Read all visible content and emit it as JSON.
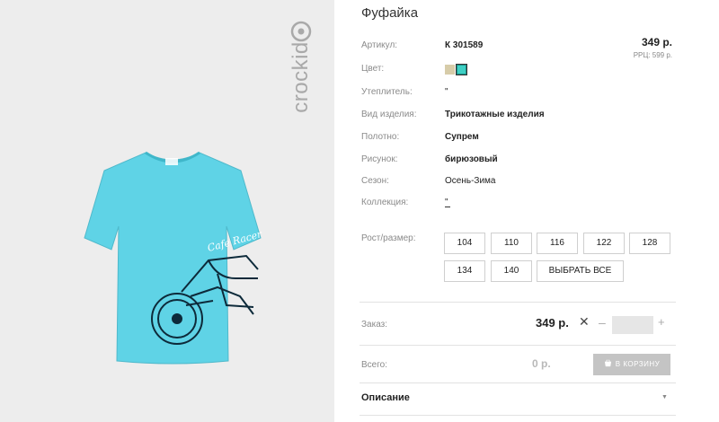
{
  "product": {
    "title": "Фуфайка",
    "brand": "crockid",
    "price": "349 р.",
    "rrp": "РРЦ: 599 р.",
    "print_text": "Cafe Racer"
  },
  "attributes": [
    {
      "label": "Артикул:",
      "value": "К 301589",
      "bold": true
    },
    {
      "label": "Цвет:",
      "value": ""
    },
    {
      "label": "Утеплитель:",
      "value": "\""
    },
    {
      "label": "Вид изделия:",
      "value": "Трикотажные изделия",
      "bold": true
    },
    {
      "label": "Полотно:",
      "value": "Супрем",
      "bold": true
    },
    {
      "label": "Рисунок:",
      "value": "бирюзовый",
      "bold": true
    },
    {
      "label": "Сезон:",
      "value": "Осень-Зима"
    },
    {
      "label": "Коллекция:",
      "value": "\""
    }
  ],
  "colors": {
    "swatch_beige": "#d7cca9",
    "swatch_turquoise": "#3fcfc4",
    "shirt": "#5fd3e6",
    "photo_bg": "#ededed",
    "button_gray": "#c4c4c4"
  },
  "sizes": {
    "label": "Рост/размер:",
    "options": [
      "104",
      "110",
      "116",
      "122",
      "128",
      "134",
      "140"
    ],
    "select_all": "ВЫБРАТЬ ВСЕ"
  },
  "order": {
    "label": "Заказ:",
    "price": "349 р.",
    "remove": "✕",
    "minus": "–",
    "plus": "+",
    "quantity": ""
  },
  "total": {
    "label": "Всего:",
    "value": "0 р.",
    "cart_button": "В КОРЗИНУ"
  },
  "description": {
    "title": "Описание",
    "arrow": "▼"
  }
}
